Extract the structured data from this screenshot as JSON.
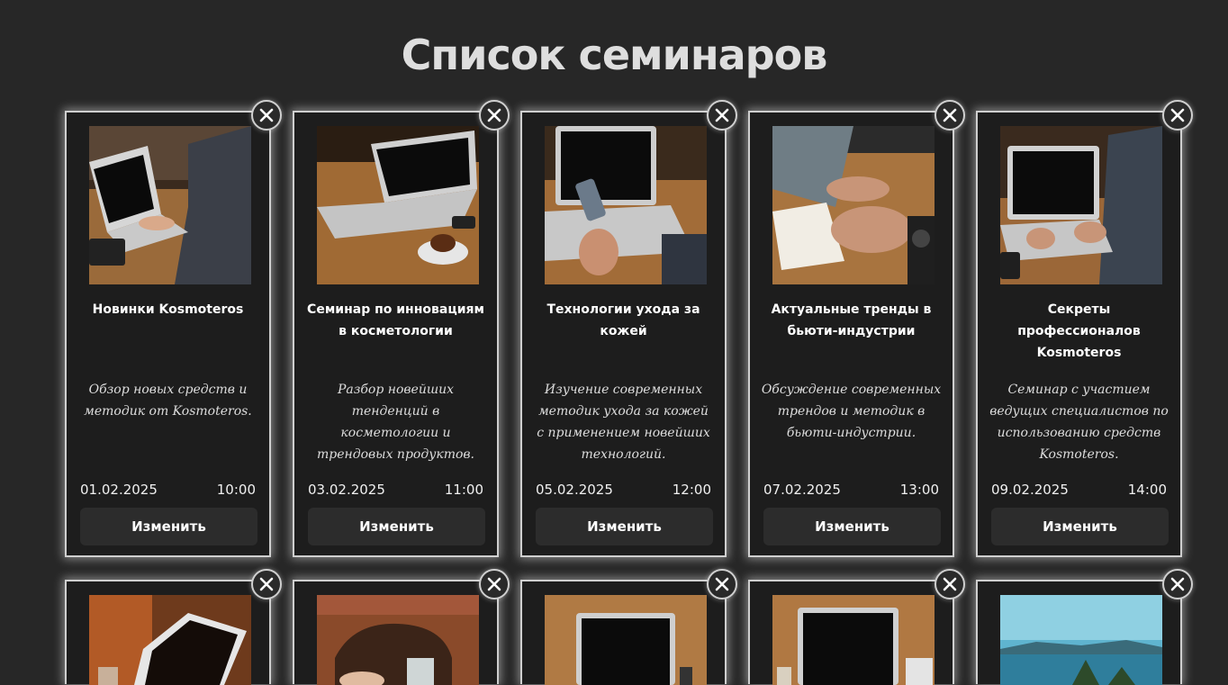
{
  "page": {
    "title": "Список семинаров"
  },
  "icons": {
    "close": "close-icon"
  },
  "colors": {
    "background": "#272727",
    "card": "#1d1d1d",
    "border": "#cfcfcf",
    "button": "#2c2c2c"
  },
  "seminars": [
    {
      "title": "Новинки Kosmoteros",
      "description": "Обзор новых средств и методик от Kosmoteros.",
      "date": "01.02.2025",
      "time": "10:00",
      "button": "Изменить"
    },
    {
      "title": "Семинар по инновациям в косметологии",
      "description": "Разбор новейших тенденций в косметологии и трендовых продуктов.",
      "date": "03.02.2025",
      "time": "11:00",
      "button": "Изменить"
    },
    {
      "title": "Технологии ухода за кожей",
      "description": "Изучение современных методик ухода за кожей с применением новейших технологий.",
      "date": "05.02.2025",
      "time": "12:00",
      "button": "Изменить"
    },
    {
      "title": "Актуальные тренды в бьюти-индустрии",
      "description": "Обсуждение современных трендов и методик в бьюти-индустрии.",
      "date": "07.02.2025",
      "time": "13:00",
      "button": "Изменить"
    },
    {
      "title": "Секреты профессионалов Kosmoteros",
      "description": "Семинар с участием ведущих специалистов по использованию средств Kosmoteros.",
      "date": "09.02.2025",
      "time": "14:00",
      "button": "Изменить"
    }
  ]
}
